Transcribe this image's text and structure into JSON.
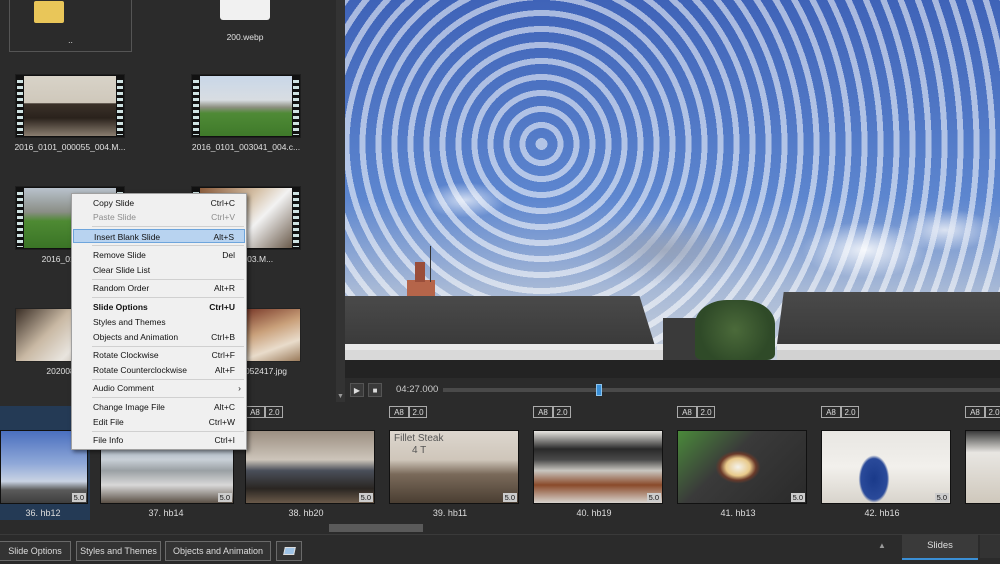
{
  "browser": {
    "files": [
      {
        "name": "..",
        "kind": "folder"
      },
      {
        "name": "200.webp",
        "kind": "image"
      },
      {
        "name": "2016_0101_000055_004.M...",
        "kind": "video"
      },
      {
        "name": "2016_0101_003041_004.c...",
        "kind": "video"
      },
      {
        "name": "2016_0101_00",
        "kind": "video"
      },
      {
        "name": "2054_003.M...",
        "kind": "video"
      },
      {
        "name": "20200820_1",
        "kind": "image"
      },
      {
        "name": "052417.jpg",
        "kind": "image"
      }
    ]
  },
  "player": {
    "play_icon": "play-icon",
    "stop_icon": "stop-icon",
    "time": "04:27.000",
    "progress": 0.28
  },
  "context_menu": {
    "items": [
      {
        "label": "Copy Slide",
        "shortcut": "Ctrl+C",
        "disabled": false
      },
      {
        "label": "Paste Slide",
        "shortcut": "Ctrl+V",
        "disabled": true
      },
      {
        "label": "Insert Blank Slide",
        "shortcut": "Alt+S",
        "highlighted": true
      },
      {
        "label": "Remove Slide",
        "shortcut": "Del"
      },
      {
        "label": "Clear Slide List",
        "shortcut": ""
      },
      {
        "label": "Random Order",
        "shortcut": "Alt+R"
      },
      {
        "label": "Slide Options",
        "shortcut": "Ctrl+U",
        "bold": true
      },
      {
        "label": "Styles and Themes",
        "shortcut": ""
      },
      {
        "label": "Objects and Animation",
        "shortcut": "Ctrl+B"
      },
      {
        "label": "Rotate Clockwise",
        "shortcut": "Ctrl+F"
      },
      {
        "label": "Rotate Counterclockwise",
        "shortcut": "Alt+F"
      },
      {
        "label": "Audio Comment",
        "shortcut": "",
        "submenu": true
      },
      {
        "label": "Change Image File",
        "shortcut": "Alt+C"
      },
      {
        "label": "Edit File",
        "shortcut": "Ctrl+W"
      },
      {
        "label": "File Info",
        "shortcut": "Ctrl+I"
      }
    ],
    "submenu_arrow": "›"
  },
  "slides": [
    {
      "caption": "36. hb12",
      "duration": "5.0",
      "selected": true
    },
    {
      "caption": "37. hb14",
      "duration": "5.0"
    },
    {
      "caption": "38. hb20",
      "duration": "5.0",
      "badge_a": "A8",
      "badge_b": "2.0"
    },
    {
      "caption": "39. hb11",
      "duration": "5.0",
      "badge_a": "A8",
      "badge_b": "2.0",
      "overlay_title": "Fillet Steak",
      "overlay_sub": "4 T"
    },
    {
      "caption": "40. hb19",
      "duration": "5.0",
      "badge_a": "A8",
      "badge_b": "2.0"
    },
    {
      "caption": "41. hb13",
      "duration": "5.0",
      "badge_a": "A8",
      "badge_b": "2.0"
    },
    {
      "caption": "42. hb16",
      "duration": "5.0",
      "badge_a": "A8",
      "badge_b": "2.0"
    },
    {
      "caption": "",
      "duration": "",
      "badge_a": "A8",
      "badge_b": "2.0"
    }
  ],
  "toolbar": {
    "slide_options": "Slide Options",
    "styles_themes": "Styles and Themes",
    "objects_animation": "Objects and Animation",
    "up_arrow": "▲",
    "tab_slides": "Slides"
  },
  "colors": {
    "accent": "#3a8fd6",
    "menu_highlight": "#b8d3f0",
    "background": "#2b2b2b"
  }
}
